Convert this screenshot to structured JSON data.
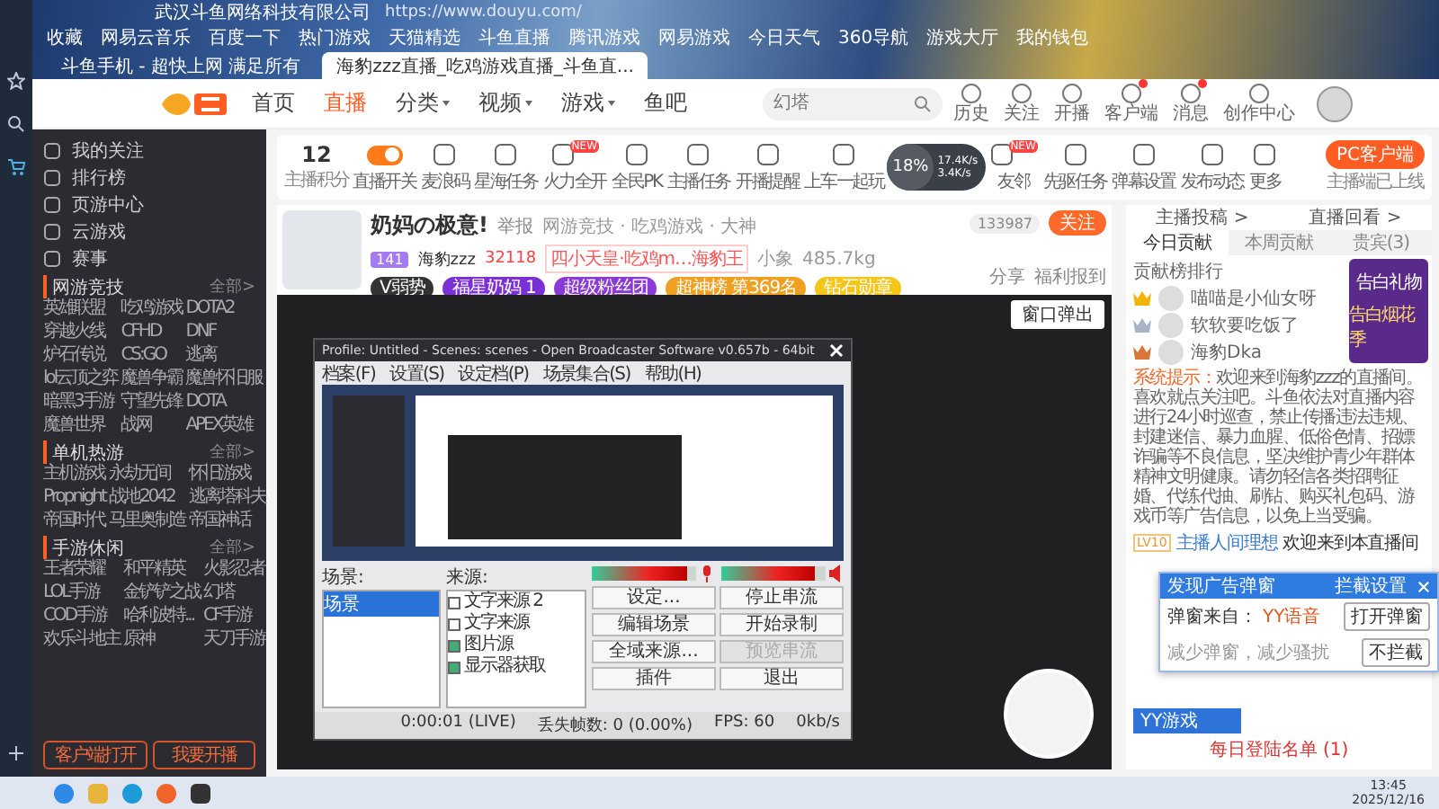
{
  "browser": {
    "page_title": "武汉斗鱼网络科技有限公司",
    "url": "https://www.douyu.com/",
    "bookmarks": [
      "收藏",
      "网易云音乐",
      "百度一下",
      "热门游戏",
      "天猫精选",
      "斗鱼直播",
      "腾讯游戏",
      "网易游戏",
      "今日天气",
      "360导航",
      "游戏大厅",
      "我的钱包"
    ],
    "tabs": [
      {
        "label": "斗鱼手机 - 超快上网 满足所有",
        "selected": false
      },
      {
        "label": "海豹zzz直播_吃鸡游戏直播_斗鱼直...",
        "selected": true
      }
    ]
  },
  "header": {
    "nav": [
      {
        "label": "首页",
        "selected": false,
        "has_menu": false
      },
      {
        "label": "直播",
        "selected": true,
        "has_menu": false
      },
      {
        "label": "分类",
        "selected": false,
        "has_menu": true
      },
      {
        "label": "视频",
        "selected": false,
        "has_menu": true
      },
      {
        "label": "游戏",
        "selected": false,
        "has_menu": true
      },
      {
        "label": "鱼吧",
        "selected": false,
        "has_menu": false
      }
    ],
    "search": {
      "placeholder": "幻塔"
    },
    "icons": [
      {
        "label": "历史",
        "dot": false
      },
      {
        "label": "关注",
        "dot": false
      },
      {
        "label": "开播",
        "dot": false
      },
      {
        "label": "客户端",
        "dot": true
      },
      {
        "label": "消息",
        "dot": true
      },
      {
        "label": "创作中心",
        "dot": false
      }
    ]
  },
  "sidebar": {
    "items": [
      "我的关注",
      "排行榜",
      "页游中心",
      "云游戏",
      "赛事"
    ],
    "sections": [
      {
        "title": "网游竞技",
        "all": "全部>",
        "games": [
          "英雄联盟",
          "吃鸡游戏",
          "DOTA2",
          "穿越火线",
          "CFHD",
          "DNF",
          "炉石传说",
          "CS:GO",
          "逃离",
          "lol云顶之弈",
          "魔兽争霸",
          "魔兽怀旧服",
          "暗黑3手游",
          "守望先锋",
          "DOTA",
          "魔兽世界",
          "战网",
          "APEX英雄"
        ]
      },
      {
        "title": "单机热游",
        "all": "全部>",
        "games": [
          "主机游戏",
          "永劫无间",
          "怀旧游戏",
          "Propnight",
          "战地2042",
          "逃离塔科夫",
          "帝国时代",
          "马里奥制造",
          "帝国神话"
        ]
      },
      {
        "title": "手游休闲",
        "all": "全部>",
        "games": [
          "王者荣耀",
          "和平精英",
          "火影忍者",
          "LOL手游",
          "金铲铲之战",
          "幻塔",
          "COD手游",
          "哈利波特...",
          "CF手游",
          "欢乐斗地主",
          "原神",
          "天刀手游"
        ]
      }
    ],
    "buttons": [
      "客户端打开",
      "我要开播"
    ]
  },
  "toolbar": {
    "score": "12",
    "score_label": "主播积分",
    "items": [
      {
        "kind": "toggle",
        "label": "直播开关",
        "on": true
      },
      {
        "kind": "icon",
        "label": "麦浪码"
      },
      {
        "kind": "icon",
        "label": "星海任务"
      },
      {
        "kind": "icon",
        "label": "火力全开",
        "tag": "NEW"
      },
      {
        "kind": "icon",
        "label": "全民PK"
      },
      {
        "kind": "icon",
        "label": "主播任务"
      },
      {
        "kind": "icon",
        "label": "开播提醒"
      },
      {
        "kind": "icon",
        "label": "上车一起玩"
      },
      {
        "kind": "icon",
        "label": "友邻",
        "tag": "NEW"
      },
      {
        "kind": "icon",
        "label": "先驱任务"
      },
      {
        "kind": "icon",
        "label": "弹幕设置"
      },
      {
        "kind": "icon",
        "label": "发布动态"
      },
      {
        "kind": "icon",
        "label": "更多"
      }
    ],
    "pc_button": "PC客户端",
    "pc_caption": "主播端已上线",
    "net": {
      "percent": "18%",
      "up": "17.4K/s",
      "down": "3.4K/s"
    }
  },
  "room": {
    "title": "奶妈の极意!",
    "report": "举报",
    "category": "网游竞技 · 吃鸡游戏 · 大神",
    "level": "141",
    "name": "海豹zzz",
    "hot": "32118",
    "rank": "四小天皇·吃鸡m…海豹王",
    "place": "小象",
    "weight": "485.7kg",
    "badges": [
      {
        "label": "V弱势",
        "color": "#333333"
      },
      {
        "label": "福星奶妈 1",
        "color": "#7b2fd6"
      },
      {
        "label": "超级粉丝团",
        "color": "#8a3ad8"
      },
      {
        "label": "超神榜 第369名",
        "color": "#f0a020"
      },
      {
        "label": "钻石勋章",
        "color": "#f5c518"
      }
    ],
    "count": "133987",
    "follow": "关注",
    "share": "分享",
    "welfare": "福利报到",
    "popout": "窗口弹出"
  },
  "obs": {
    "title": "Profile: Untitled - Scenes: scenes - Open Broadcaster Software v0.657b - 64bit",
    "menu": [
      "档案(F)",
      "设置(S)",
      "设定档(P)",
      "场景集合(S)",
      "帮助(H)"
    ],
    "scenes_label": "场景:",
    "scenes": [
      {
        "label": "场景",
        "selected": true
      }
    ],
    "sources_label": "来源:",
    "sources": [
      {
        "label": "文字来源 2",
        "checked": false
      },
      {
        "label": "文字来源",
        "checked": false
      },
      {
        "label": "图片源",
        "checked": true
      },
      {
        "label": "显示器获取",
        "checked": true
      }
    ],
    "meters": [
      {
        "kind": "mic",
        "level": 0.92
      },
      {
        "kind": "speaker",
        "level": 0.9
      }
    ],
    "buttons": [
      {
        "label": "设定...",
        "disabled": false
      },
      {
        "label": "停止串流",
        "disabled": false
      },
      {
        "label": "编辑场景",
        "disabled": false
      },
      {
        "label": "开始录制",
        "disabled": false
      },
      {
        "label": "全域来源...",
        "disabled": false
      },
      {
        "label": "预览串流",
        "disabled": true
      },
      {
        "label": "插件",
        "disabled": false
      },
      {
        "label": "退出",
        "disabled": false
      }
    ],
    "status": [
      "0:00:01 (LIVE)",
      "丢失帧数: 0 (0.00%)",
      "FPS: 60",
      "0kb/s"
    ]
  },
  "chat": {
    "links": [
      "主播投稿 >",
      "直播回看 >"
    ],
    "tabs": [
      {
        "label": "今日贡献",
        "selected": true
      },
      {
        "label": "本周贡献",
        "selected": false
      },
      {
        "label": "贵宾(3)",
        "selected": false
      }
    ],
    "rank_title": "贡献榜排行",
    "ranks": [
      {
        "name": "喵喵是小仙女呀",
        "color": "#f2b400"
      },
      {
        "name": "软软要吃饭了",
        "color": "#a9b4c8"
      },
      {
        "name": "海豹Dka",
        "color": "#d9773a"
      }
    ],
    "notice": {
      "label": "系统提示：",
      "text": "欢迎来到海豹zzz的直播间。喜欢就点关注吧。斗鱼依法对直播内容进行24小时巡查，禁止传播违法违规、封建迷信、暴力血腥、低俗色情、招嫖诈骗等不良信息，坚决维护青少年群体精神文明健康。请勿轻信各类招聘征婚、代练代抽、刷钻、购买礼包码、游戏币等广告信息，以免上当受骗。"
    },
    "messages": [
      {
        "level": "LV10",
        "user": "主播人间理想",
        "text": "欢迎来到本直播间"
      }
    ],
    "bottom_tab": "YY游戏",
    "login_list": "每日登陆名单 (1)",
    "gift": {
      "title": "告白礼物",
      "caption": "告白烟花季"
    }
  },
  "popup": {
    "title": "发现广告弹窗",
    "settings": "拦截设置",
    "source_label": "弹窗来自：",
    "source": "YY语音",
    "hint": "减少弹窗，减少骚扰",
    "open": "打开弹窗",
    "ignore": "不拦截"
  },
  "taskbar": {
    "time": "13:45",
    "date": "2025/12/16"
  }
}
